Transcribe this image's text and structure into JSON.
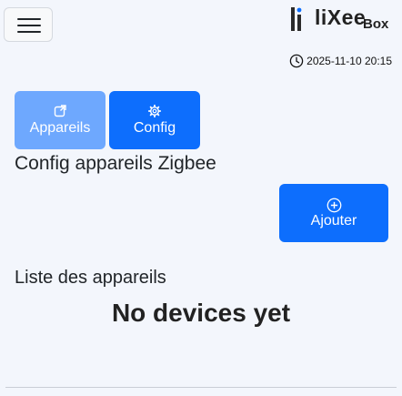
{
  "header": {
    "logo_text": "liXee",
    "logo_suffix": "Box",
    "datetime": "2025-11-10 20:15"
  },
  "tabs": [
    {
      "label": "Appareils",
      "icon": "external-link-icon",
      "active": true
    },
    {
      "label": "Config",
      "icon": "gear-icon",
      "active": false
    }
  ],
  "page": {
    "title": "Config appareils Zigbee",
    "add_button_label": "Ajouter",
    "list_title": "Liste des appareils",
    "empty_message": "No devices yet"
  },
  "colors": {
    "primary": "#0d6efd",
    "primary_light": "#6ea8fe",
    "background": "#f3f6fc"
  }
}
